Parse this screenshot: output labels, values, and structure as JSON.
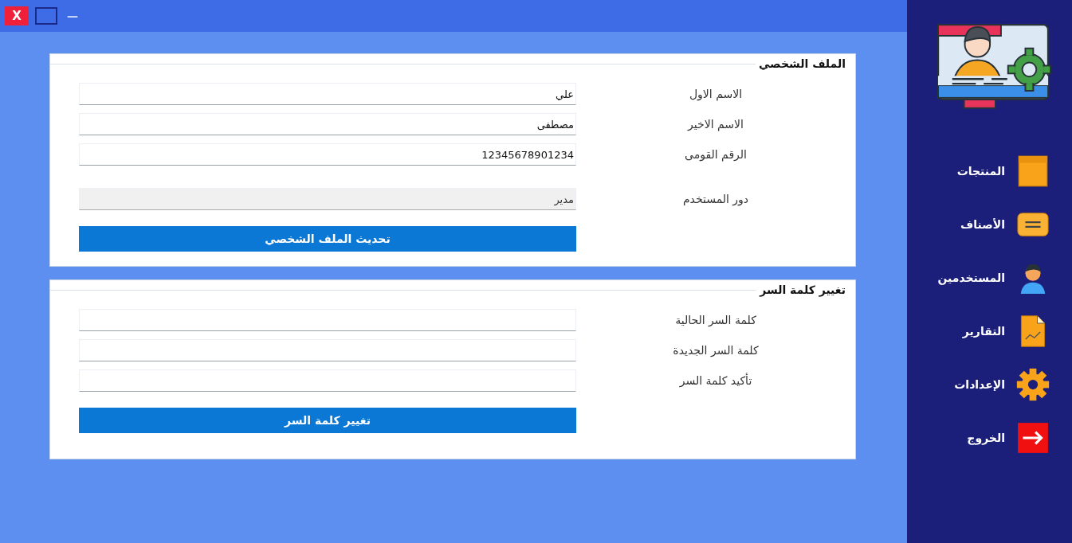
{
  "window": {
    "controls": [
      {
        "kind": "minimize",
        "label": "—"
      },
      {
        "kind": "maximize"
      },
      {
        "kind": "close",
        "label": "X"
      }
    ]
  },
  "sections": [
    {
      "title": "الملف الشخصي",
      "fields": [
        {
          "label": "الاسم الاول",
          "value": "علي",
          "disabled": false
        },
        {
          "label": "الاسم الاخير",
          "value": "مصطفى",
          "disabled": false
        },
        {
          "label": "الرقم القومى",
          "value": "12345678901234",
          "disabled": false
        },
        {
          "label": "دور المستخدم",
          "value": "مدير",
          "disabled": true
        }
      ],
      "button": "تحديث الملف الشخصي"
    },
    {
      "title": "تغيير كلمة السر",
      "fields": [
        {
          "label": "كلمة السر الحالية",
          "disabled": false
        },
        {
          "label": "كلمة السر الجديدة",
          "disabled": false
        },
        {
          "label": "تأكيد كلمة السر",
          "disabled": false
        }
      ],
      "button": "تغيير كلمة السر"
    }
  ],
  "sidebar": {
    "items": [
      {
        "label": "المنتجات",
        "kind": "box"
      },
      {
        "label": "الأصناف",
        "kind": "tag"
      },
      {
        "label": "المستخدمين",
        "kind": "user"
      },
      {
        "label": "التقارير",
        "kind": "report"
      },
      {
        "label": "الإعدادات",
        "kind": "gear"
      },
      {
        "label": "الخروج",
        "kind": "exit"
      }
    ]
  }
}
